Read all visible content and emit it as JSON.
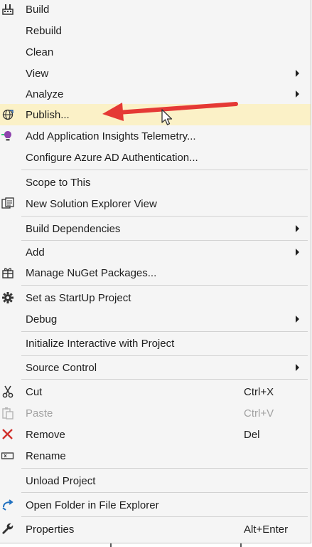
{
  "menu": {
    "items": [
      {
        "label": "Build",
        "icon": "build-icon"
      },
      {
        "label": "Rebuild"
      },
      {
        "label": "Clean"
      },
      {
        "label": "View",
        "submenu": true
      },
      {
        "label": "Analyze",
        "submenu": true
      },
      {
        "label": "Publish...",
        "icon": "publish-globe-icon",
        "highlighted": true
      },
      {
        "label": "Add Application Insights Telemetry...",
        "icon": "application-insights-icon"
      },
      {
        "label": "Configure Azure AD Authentication..."
      },
      {
        "label": "Scope to This"
      },
      {
        "label": "New Solution Explorer View",
        "icon": "new-solution-explorer-view-icon"
      },
      {
        "label": "Build Dependencies",
        "submenu": true
      },
      {
        "label": "Add",
        "submenu": true
      },
      {
        "label": "Manage NuGet Packages...",
        "icon": "nuget-packages-icon"
      },
      {
        "label": "Set as StartUp Project",
        "icon": "gear-icon"
      },
      {
        "label": "Debug",
        "submenu": true
      },
      {
        "label": "Initialize Interactive with Project"
      },
      {
        "label": "Source Control",
        "submenu": true
      },
      {
        "label": "Cut",
        "shortcut": "Ctrl+X",
        "icon": "scissors-icon"
      },
      {
        "label": "Paste",
        "shortcut": "Ctrl+V",
        "icon": "paste-icon",
        "disabled": true
      },
      {
        "label": "Remove",
        "shortcut": "Del",
        "icon": "remove-x-icon"
      },
      {
        "label": "Rename",
        "icon": "rename-icon"
      },
      {
        "label": "Unload Project"
      },
      {
        "label": "Open Folder in File Explorer",
        "icon": "open-folder-arrow-icon"
      },
      {
        "label": "Properties",
        "shortcut": "Alt+Enter",
        "icon": "wrench-icon"
      }
    ]
  },
  "colors": {
    "highlight": "#fbf1c7",
    "annotation_arrow": "#e53935",
    "menu_background": "#f5f5f5"
  }
}
